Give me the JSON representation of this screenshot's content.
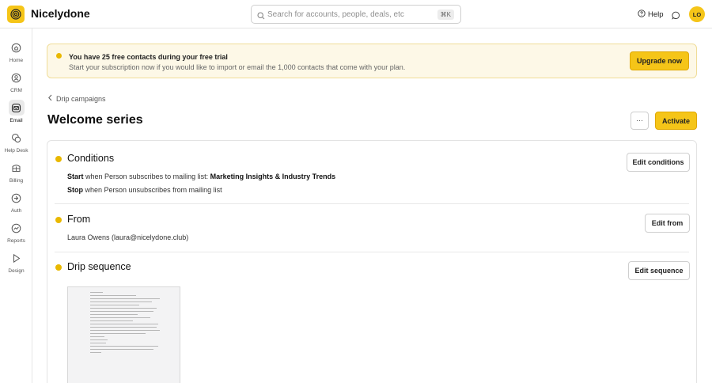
{
  "app": {
    "name": "Nicelydone"
  },
  "search": {
    "placeholder": "Search for accounts, people, deals, etc",
    "shortcut": "⌘K"
  },
  "header": {
    "help_label": "Help",
    "user_initials": "LO"
  },
  "sidebar": {
    "items": [
      {
        "label": "Home",
        "icon": "home-icon",
        "active": false
      },
      {
        "label": "CRM",
        "icon": "crm-icon",
        "active": false
      },
      {
        "label": "Email",
        "icon": "email-icon",
        "active": true
      },
      {
        "label": "Help Desk",
        "icon": "help-desk-icon",
        "active": false
      },
      {
        "label": "Billing",
        "icon": "billing-icon",
        "active": false
      },
      {
        "label": "Auth",
        "icon": "auth-icon",
        "active": false
      },
      {
        "label": "Reports",
        "icon": "reports-icon",
        "active": false
      },
      {
        "label": "Design",
        "icon": "design-icon",
        "active": false
      }
    ]
  },
  "banner": {
    "title": "You have 25 free contacts during your free trial",
    "text": "Start your subscription now if you would like to import or email the 1,000 contacts that come with your plan.",
    "button": "Upgrade now"
  },
  "breadcrumb": {
    "back_label": "Drip campaigns"
  },
  "page": {
    "title": "Welcome series",
    "more_label": "···",
    "activate_label": "Activate"
  },
  "conditions": {
    "title": "Conditions",
    "start_keyword": "Start",
    "start_text": "when Person subscribes to mailing list:",
    "start_list": "Marketing Insights & Industry Trends",
    "stop_keyword": "Stop",
    "stop_text": "when Person unsubscribes from mailing list",
    "edit_label": "Edit conditions"
  },
  "from": {
    "title": "From",
    "value": "Laura Owens (laura@nicelydone.club)",
    "edit_label": "Edit from"
  },
  "sequence": {
    "title": "Drip sequence",
    "edit_label": "Edit sequence"
  },
  "colors": {
    "accent": "#f5c518",
    "accent_border": "#e0a800",
    "banner_bg": "#fdf8e7",
    "banner_border": "#f0dd98",
    "dot": "#e9b800"
  }
}
